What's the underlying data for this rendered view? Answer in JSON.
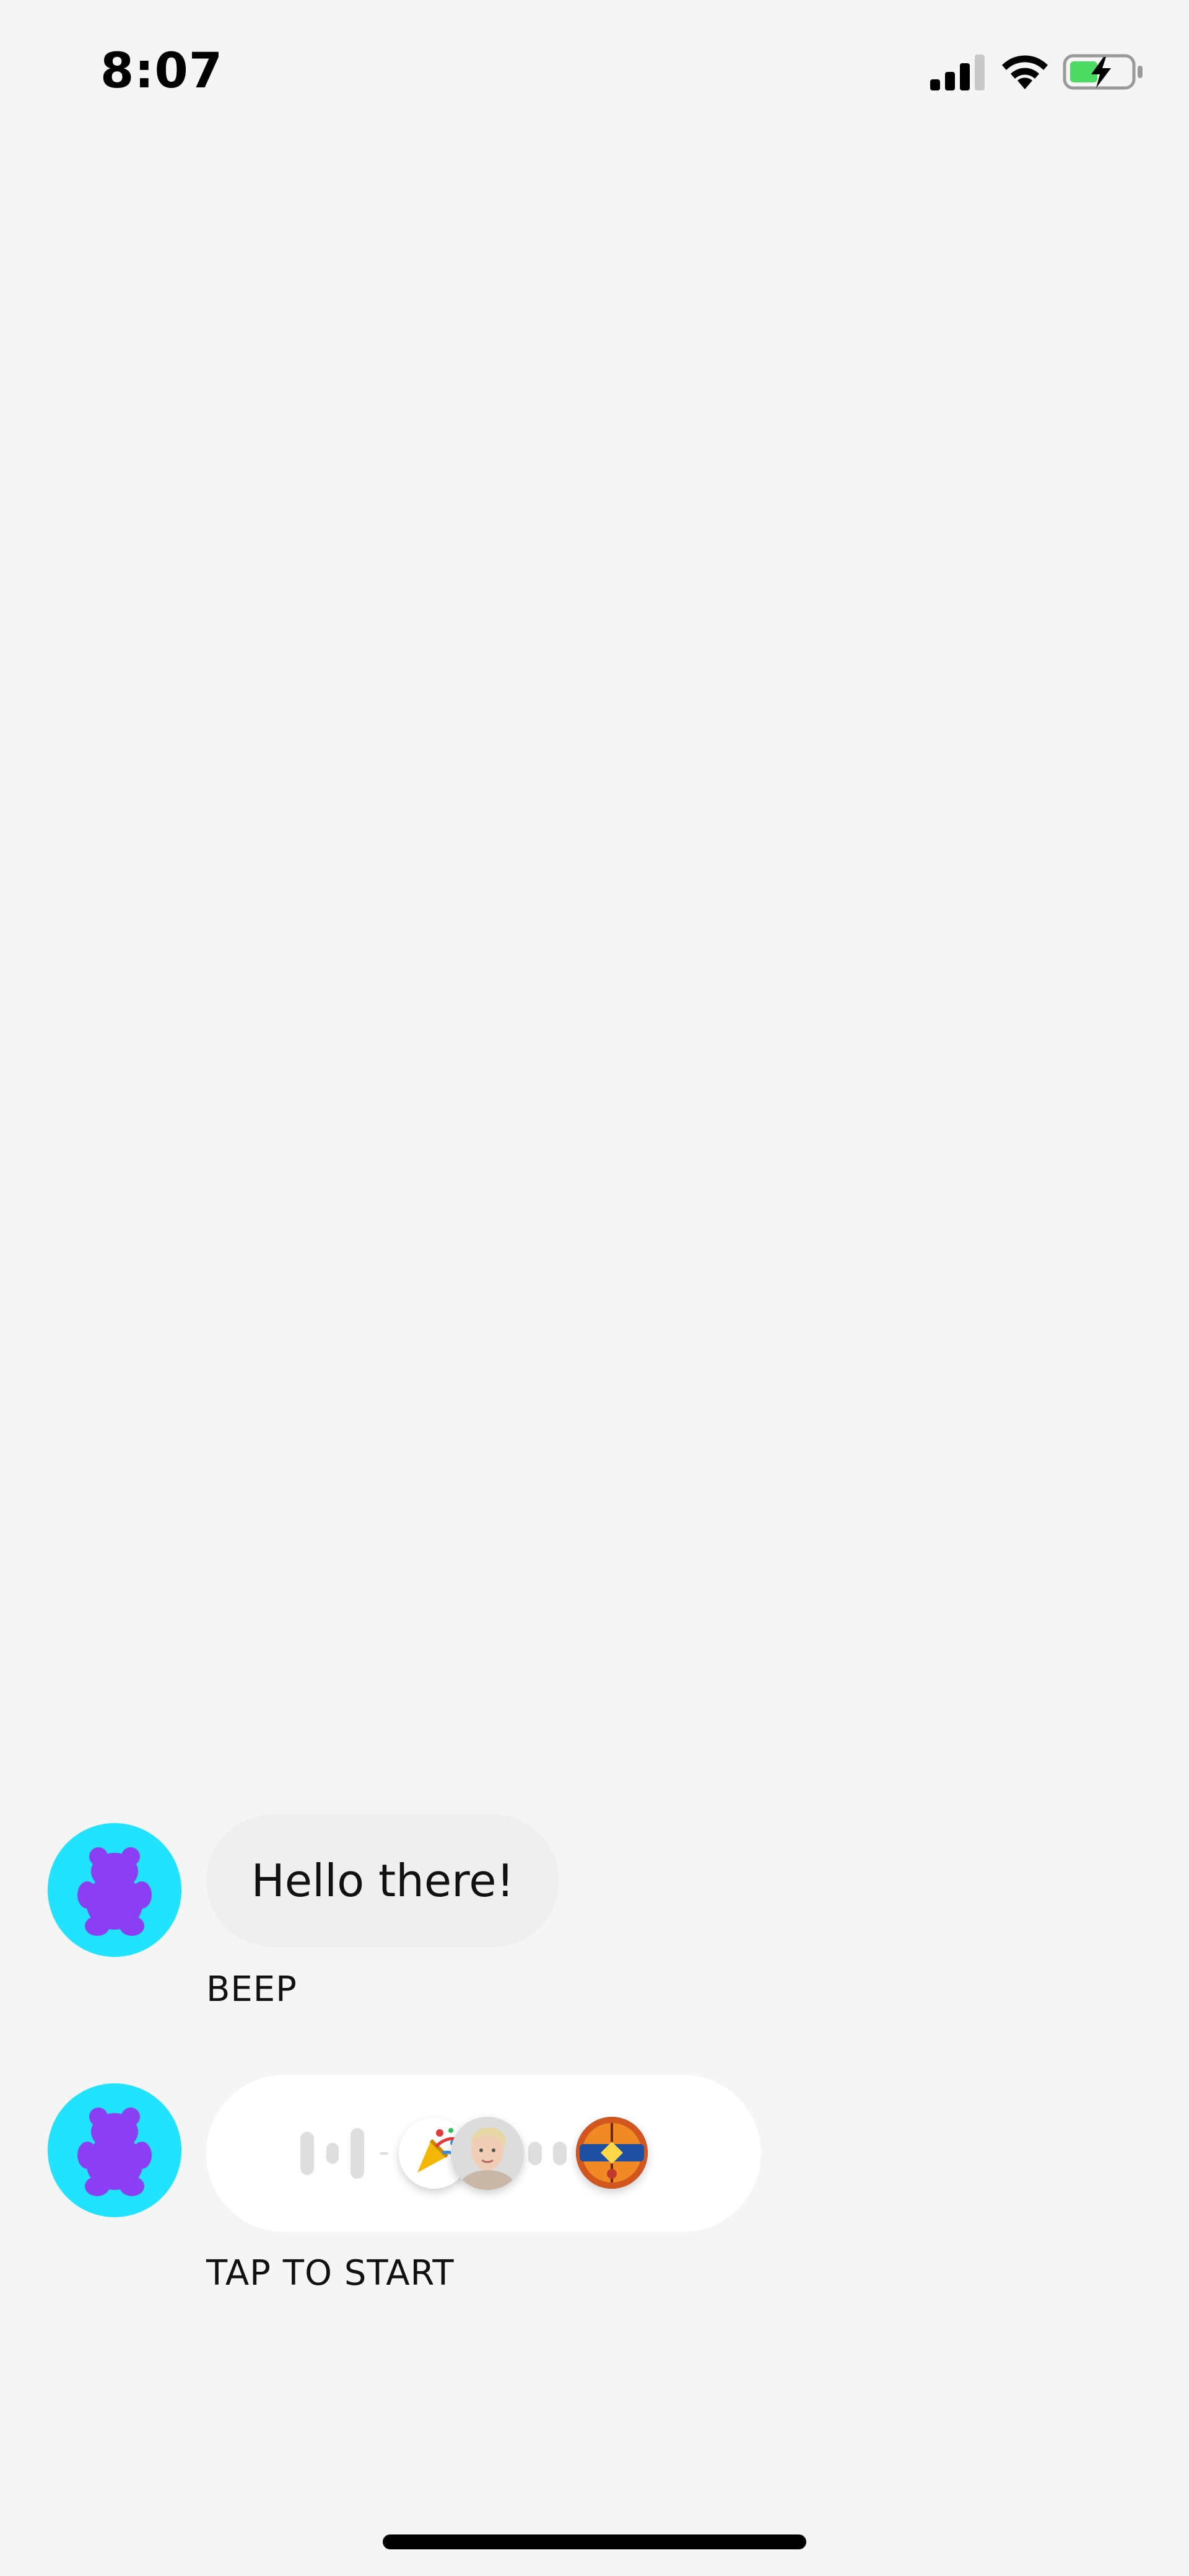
{
  "status_bar": {
    "time": "8:07",
    "icons": [
      "signal-icon",
      "wifi-icon",
      "battery-charging-icon"
    ],
    "battery_color": "#4cd964"
  },
  "messages": [
    {
      "avatar": "gummy-bear-avatar",
      "text": "Hello there!",
      "label": "BEEP"
    },
    {
      "avatar": "gummy-bear-avatar",
      "media": [
        "audio-waveform",
        "party-popper-thumbnail",
        "person-photo-thumbnail",
        "nba-jam-thumbnail"
      ],
      "label": "TAP TO START"
    }
  ],
  "colors": {
    "background": "#f5f5f5",
    "avatar_bg": "#22e3ff",
    "bear": "#8a3ff2",
    "bubble_gray": "#efefef",
    "bubble_white": "#ffffff"
  }
}
